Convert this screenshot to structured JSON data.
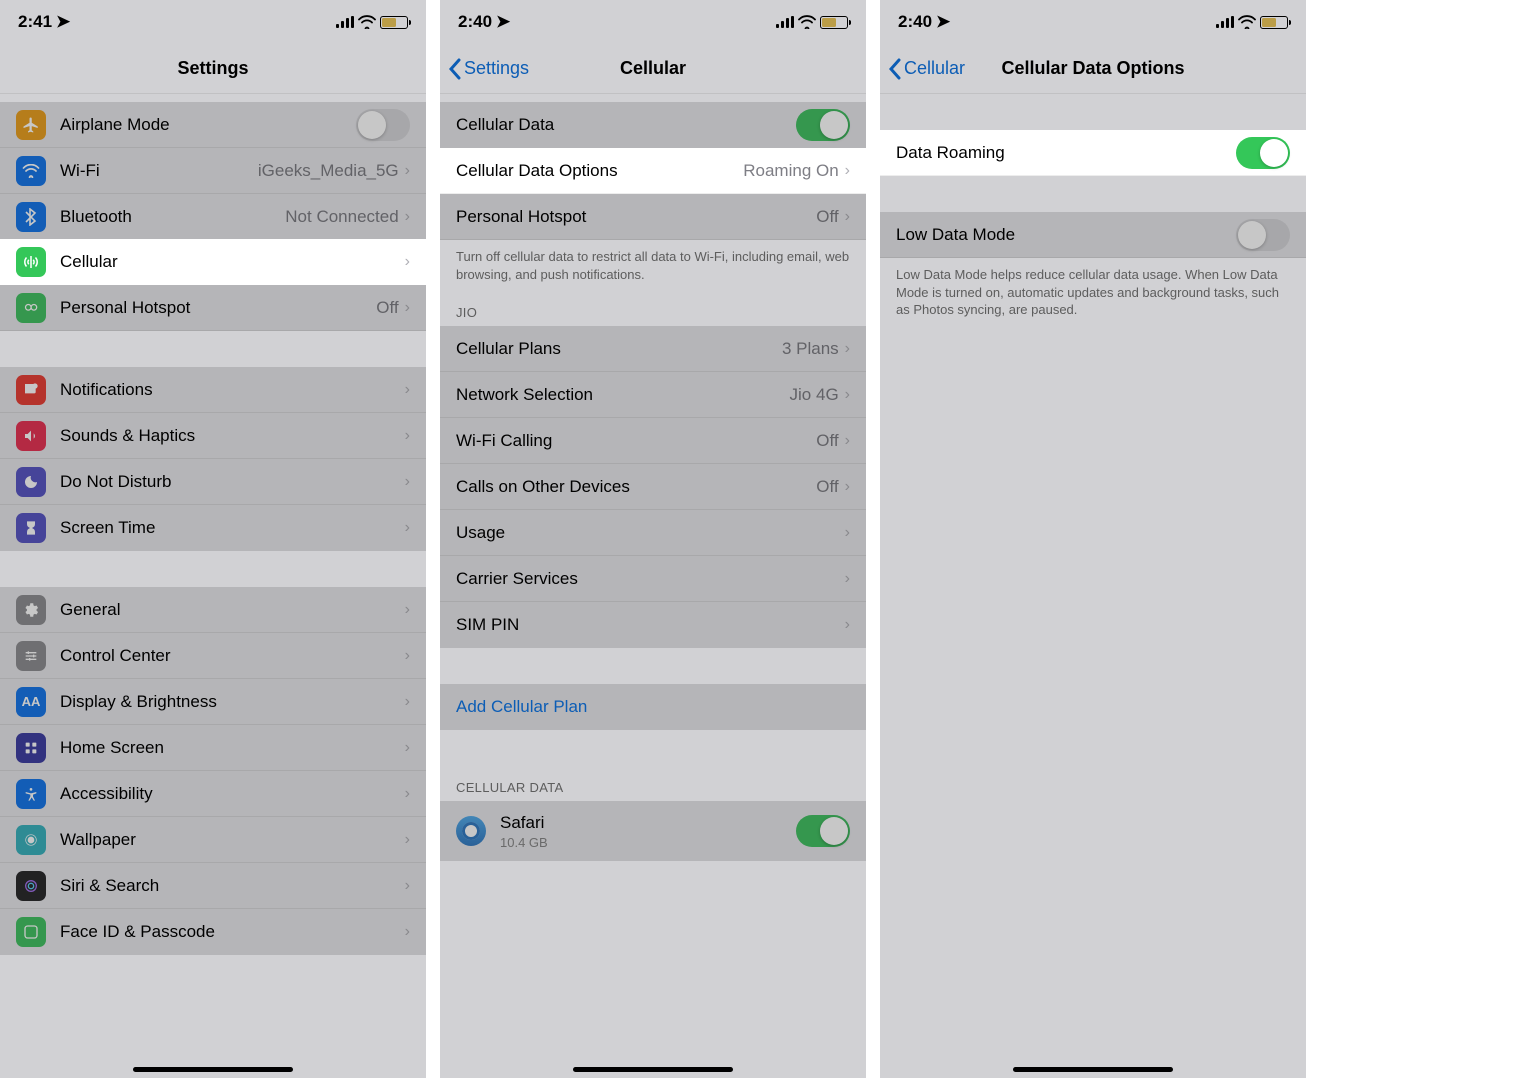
{
  "screen1": {
    "time": "2:41",
    "title": "Settings",
    "rows": {
      "airplane": "Airplane Mode",
      "wifi": "Wi-Fi",
      "wifi_val": "iGeeks_Media_5G",
      "bt": "Bluetooth",
      "bt_val": "Not Connected",
      "cellular": "Cellular",
      "hotspot": "Personal Hotspot",
      "hotspot_val": "Off",
      "notif": "Notifications",
      "sounds": "Sounds & Haptics",
      "dnd": "Do Not Disturb",
      "screentime": "Screen Time",
      "general": "General",
      "control": "Control Center",
      "display": "Display & Brightness",
      "home": "Home Screen",
      "access": "Accessibility",
      "wallpaper": "Wallpaper",
      "siri": "Siri & Search",
      "faceid": "Face ID & Passcode"
    }
  },
  "screen2": {
    "time": "2:40",
    "back": "Settings",
    "title": "Cellular",
    "rows": {
      "cdata": "Cellular Data",
      "cdopt": "Cellular Data Options",
      "cdopt_val": "Roaming On",
      "hotspot": "Personal Hotspot",
      "hotspot_val": "Off"
    },
    "footer1": "Turn off cellular data to restrict all data to Wi-Fi, including email, web browsing, and push notifications.",
    "jio_header": "JIO",
    "jio": {
      "plans": "Cellular Plans",
      "plans_val": "3 Plans",
      "network": "Network Selection",
      "network_val": "Jio 4G",
      "wificall": "Wi-Fi Calling",
      "wificall_val": "Off",
      "other": "Calls on Other Devices",
      "other_val": "Off",
      "usage": "Usage",
      "carrier": "Carrier Services",
      "simpin": "SIM PIN"
    },
    "addplan": "Add Cellular Plan",
    "cd_header": "CELLULAR DATA",
    "safari": "Safari",
    "safari_size": "10.4 GB"
  },
  "screen3": {
    "time": "2:40",
    "back": "Cellular",
    "title": "Cellular Data Options",
    "roaming": "Data Roaming",
    "lowdata": "Low Data Mode",
    "low_footer": "Low Data Mode helps reduce cellular data usage. When Low Data Mode is turned on, automatic updates and background tasks, such as Photos syncing, are paused."
  }
}
